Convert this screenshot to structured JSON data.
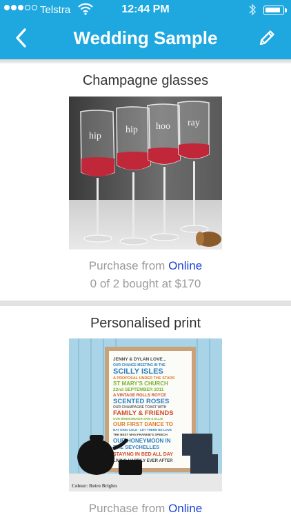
{
  "status_bar": {
    "signal_filled": 3,
    "signal_total": 5,
    "carrier": "Telstra",
    "time": "12:44 PM"
  },
  "nav": {
    "title": "Wedding Sample",
    "back_icon": "chevron-left-icon",
    "edit_icon": "pencil-icon"
  },
  "items": [
    {
      "title": "Champagne glasses",
      "image_text": [
        "hip",
        "hip",
        "hoo",
        "ray"
      ],
      "purchase_prefix": "Purchase from",
      "purchase_link": "Online",
      "bought": "0 of 2 bought at $170"
    },
    {
      "title": "Personalised print",
      "image_text": [
        "JENNY & DYLAN LOVE...",
        "OUR CHANCE MEETING IN THE",
        "SCILLY ISLES",
        "A PROPOSAL UNDER THE STARS",
        "ST MARY'S CHURCH",
        "22nd SEPTEMBER 2011",
        "A VINTAGE ROLLS ROYCE",
        "SCENTED ROSES",
        "OUR CHAMPAGNE TOAST WITH",
        "FAMILY & FRIENDS",
        "OUR BRIDESMAIDS SAM & ELLIE",
        "OUR FIRST DANCE TO",
        "NAT KING COLE - LET THERE BE LOVE",
        "THE BEST MAN FRANKIE'S SPEECH",
        "OUR HONEYMOON IN",
        "THE SEYCHELLES",
        "STAYING IN BED ALL DAY",
        "LIVING HAPPILY EVER AFTER"
      ],
      "image_caption": "Colour: Retro Brights",
      "purchase_prefix": "Purchase from",
      "purchase_link": "Online"
    }
  ],
  "colors": {
    "nav_bar": "#1ea8df",
    "link": "#1a3fd6",
    "muted_text": "#9a9a9a"
  }
}
